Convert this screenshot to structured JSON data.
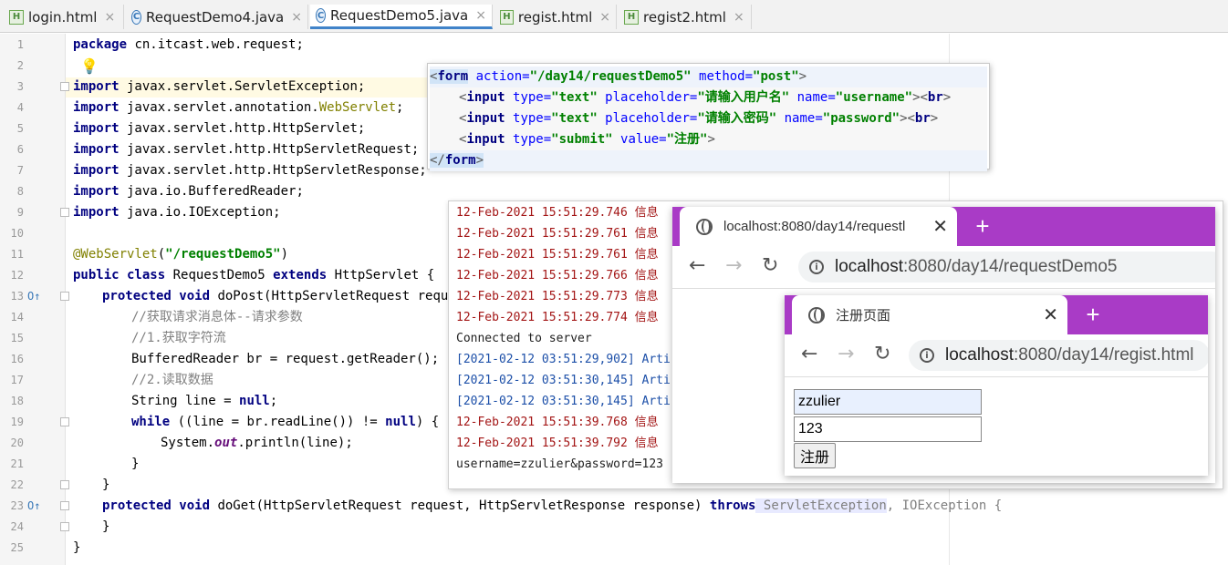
{
  "tabs": [
    {
      "label": "login.html",
      "icon": "html-file-icon"
    },
    {
      "label": "RequestDemo4.java",
      "icon": "java-class-icon"
    },
    {
      "label": "RequestDemo5.java",
      "icon": "java-class-icon",
      "active": true
    },
    {
      "label": "regist.html",
      "icon": "html-file-icon"
    },
    {
      "label": "regist2.html",
      "icon": "html-file-icon"
    }
  ],
  "editor": {
    "line_numbers": [
      "1",
      "2",
      "3",
      "4",
      "5",
      "6",
      "7",
      "8",
      "9",
      "10",
      "11",
      "12",
      "13",
      "14",
      "15",
      "16",
      "17",
      "18",
      "19",
      "20",
      "21",
      "22",
      "23",
      "24",
      "25"
    ],
    "lines": {
      "l1_kw": "package",
      "l1": " cn.itcast.web.request;",
      "l3_kw": "import",
      "l3": " javax.servlet.ServletException;",
      "l4_kw": "import",
      "l4a": " javax.servlet.annotation.",
      "l4b": "WebServlet",
      "l4c": ";",
      "l5_kw": "import",
      "l5": " javax.servlet.http.HttpServlet;",
      "l6_kw": "import",
      "l6": " javax.servlet.http.HttpServletRequest;",
      "l7_kw": "import",
      "l7": " javax.servlet.http.HttpServletResponse;",
      "l8_kw": "import",
      "l8": " java.io.BufferedReader;",
      "l9_kw": "import",
      "l9": " java.io.IOException;",
      "l11a": "@WebServlet",
      "l11b": "(",
      "l11c": "\"/requestDemo5\"",
      "l11d": ")",
      "l12a": "public class",
      "l12b": " RequestDemo5 ",
      "l12c": "extends",
      "l12d": " HttpServlet {",
      "l13a": "protected void",
      "l13b": " doPost(HttpServletRequest reques",
      "l14": "//获取请求消息体--请求参数",
      "l15": "//1.获取字符流",
      "l16": "BufferedReader br = request.getReader();",
      "l17": "//2.读取数据",
      "l18a": "String line = ",
      "l18b": "null",
      "l18c": ";",
      "l19a": "while",
      "l19b": " ((line = br.readLine()) != ",
      "l19c": "null",
      "l19d": ") {",
      "l20a": "System.",
      "l20b": "out",
      "l20c": ".println(line);",
      "l21": "}",
      "l22": "}",
      "l23a": "protected void",
      "l23b": " doGet(HttpServletRequest request, HttpServletResponse response) ",
      "l23c": "throws",
      "l23d": " ServletException",
      "l23e": ", IOException {",
      "l24": "}",
      "l25": "}"
    }
  },
  "popup": {
    "l1a": "<",
    "l1b": "form",
    "l1c": " action=",
    "l1d": "\"/day14/requestDemo5\"",
    "l1e": " method=",
    "l1f": "\"post\"",
    "l1g": ">",
    "l2a": "<",
    "l2b": "input",
    "l2c": " type=",
    "l2d": "\"text\"",
    "l2e": " placeholder=",
    "l2f": "\"请输入用户名\"",
    "l2g": " name=",
    "l2h": "\"username\"",
    "l2i": "><",
    "l2j": "br",
    "l2k": ">",
    "l3a": "<",
    "l3b": "input",
    "l3c": " type=",
    "l3d": "\"text\"",
    "l3e": " placeholder=",
    "l3f": "\"请输入密码\"",
    "l3g": " name=",
    "l3h": "\"password\"",
    "l3i": "><",
    "l3j": "br",
    "l3k": ">",
    "l4a": "<",
    "l4b": "input",
    "l4c": " type=",
    "l4d": "\"submit\"",
    "l4e": " value=",
    "l4f": "\"注册\"",
    "l4g": ">",
    "l5a": "</",
    "l5b": "form",
    "l5c": ">"
  },
  "console": {
    "lines": [
      "12-Feb-2021 15:51:29.746 信息",
      "12-Feb-2021 15:51:29.761 信息",
      "12-Feb-2021 15:51:29.761 信息",
      "12-Feb-2021 15:51:29.766 信息",
      "12-Feb-2021 15:51:29.773 信息",
      "12-Feb-2021 15:51:29.774 信息",
      "Connected to server",
      "[2021-02-12 03:51:29,902] Arti",
      "[2021-02-12 03:51:30,145] Arti",
      "[2021-02-12 03:51:30,145] Arti",
      "12-Feb-2021 15:51:39.768 信息",
      "12-Feb-2021 15:51:39.792 信息",
      "username=zzulier&password=123"
    ]
  },
  "browser1": {
    "tab_title": "localhost:8080/day14/requestl",
    "url_host": "localhost",
    "url_path": ":8080/day14/requestDemo5"
  },
  "browser2": {
    "tab_title": "注册页面",
    "url_host": "localhost",
    "url_path": ":8080/day14/regist.html",
    "username_value": "zzulier",
    "password_value": "123",
    "submit_label": "注册"
  },
  "colors": {
    "browser_accent": "#a93bc6",
    "keyword": "#000080",
    "string": "#008000",
    "annotation": "#808000",
    "console_red": "#a31515"
  }
}
